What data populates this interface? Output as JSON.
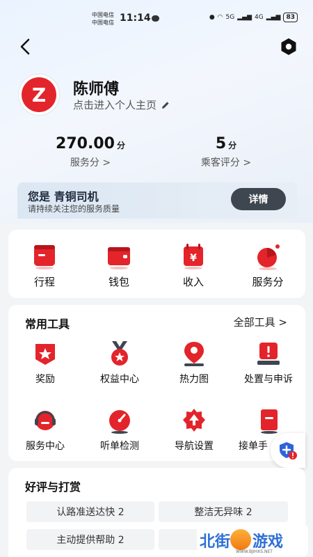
{
  "status_bar": {
    "carrier_1": "中国电信",
    "carrier_2": "中国电信",
    "time": "11:14",
    "signal_1": "5G",
    "signal_2": "4G",
    "battery": "83"
  },
  "profile": {
    "name": "陈师傅",
    "link_label": "点击进入个人主页"
  },
  "stats": [
    {
      "value": "270.00",
      "unit": "分",
      "label": "服务分 >"
    },
    {
      "value": "5",
      "unit": "分",
      "label": "乘客评分 >"
    }
  ],
  "level": {
    "prefix": "您是",
    "title": "青铜司机",
    "subtitle": "请持续关注您的服务质量",
    "detail_label": "详情"
  },
  "quick_actions": [
    {
      "label": "行程",
      "icon": "trip-icon"
    },
    {
      "label": "钱包",
      "icon": "wallet-icon"
    },
    {
      "label": "收入",
      "icon": "income-icon"
    },
    {
      "label": "服务分",
      "icon": "service-score-icon"
    }
  ],
  "tools": {
    "title": "常用工具",
    "more_label": "全部工具 >",
    "items": [
      {
        "label": "奖励",
        "icon": "reward-icon"
      },
      {
        "label": "权益中心",
        "icon": "benefits-icon"
      },
      {
        "label": "热力图",
        "icon": "heatmap-icon"
      },
      {
        "label": "处置与申诉",
        "icon": "appeal-icon"
      },
      {
        "label": "服务中心",
        "icon": "service-center-icon"
      },
      {
        "label": "听单检测",
        "icon": "order-check-icon"
      },
      {
        "label": "导航设置",
        "icon": "nav-settings-icon"
      },
      {
        "label": "接单手",
        "icon": "order-taking-icon"
      }
    ]
  },
  "reviews": {
    "title": "好评与打赏",
    "tags": [
      "认路准送达快 2",
      "整洁无异味 2",
      "主动提供帮助 2"
    ]
  },
  "watermark": {
    "brand_a": "北街",
    "brand_b": "游戏",
    "url": "WWW.BJIHXS.NET"
  },
  "colors": {
    "accent_red": "#e3242b",
    "button_dark": "#3e4650"
  }
}
